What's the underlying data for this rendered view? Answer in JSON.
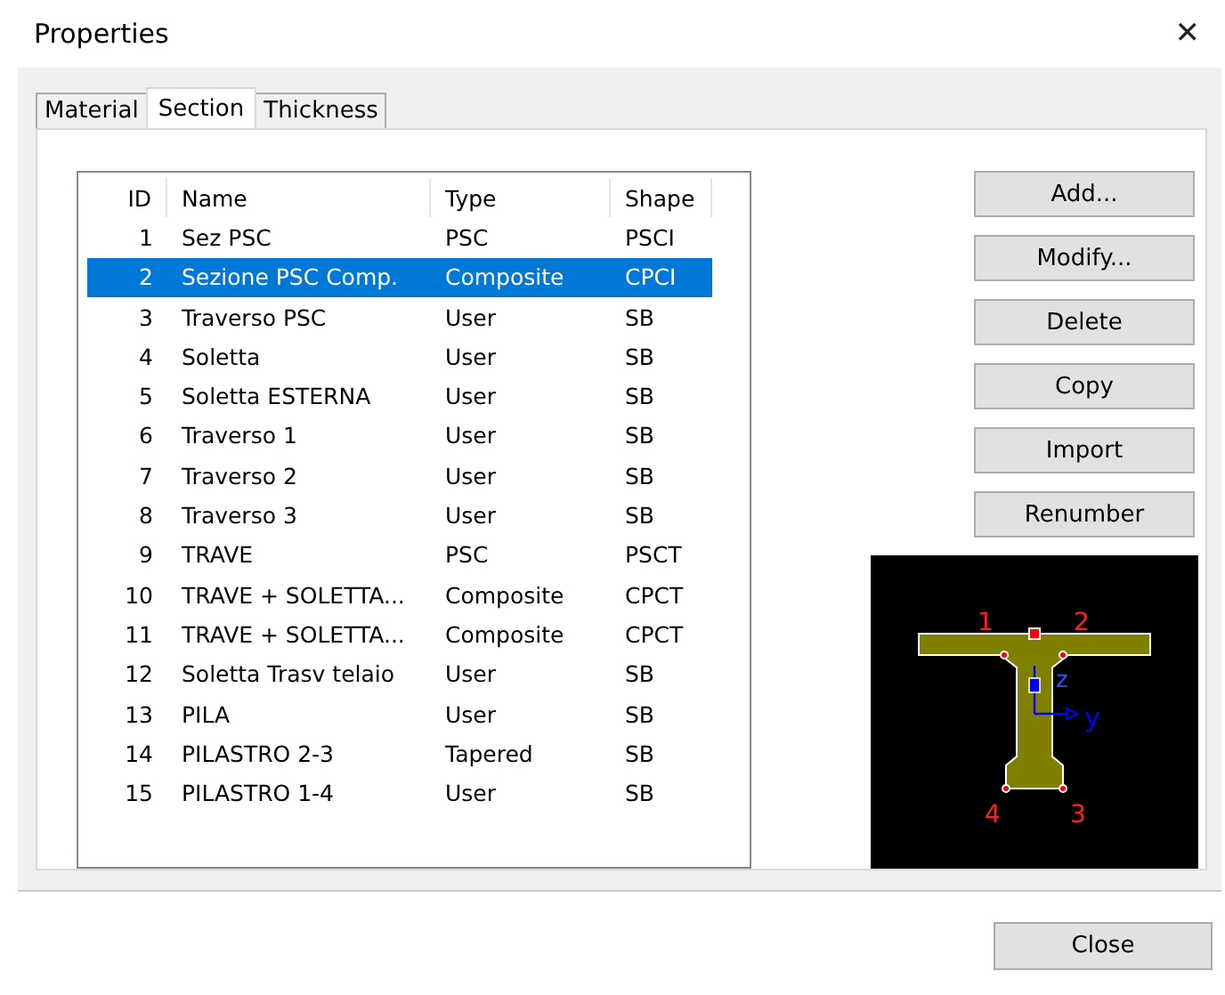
{
  "window": {
    "title": "Properties",
    "close": "✕"
  },
  "tabs": [
    {
      "label": "Material",
      "selected": false
    },
    {
      "label": "Section",
      "selected": true
    },
    {
      "label": "Thickness",
      "selected": false
    }
  ],
  "table": {
    "columns": [
      "ID",
      "Name",
      "Type",
      "Shape"
    ],
    "rows": [
      {
        "id": "1",
        "name": "Sez PSC",
        "type": "PSC",
        "shape": "PSCI",
        "selected": false
      },
      {
        "id": "2",
        "name": "Sezione PSC Comp.",
        "type": "Composite",
        "shape": "CPCI",
        "selected": true
      },
      {
        "id": "3",
        "name": "Traverso PSC",
        "type": "User",
        "shape": "SB",
        "selected": false
      },
      {
        "id": "4",
        "name": "Soletta",
        "type": "User",
        "shape": "SB",
        "selected": false
      },
      {
        "id": "5",
        "name": "Soletta ESTERNA",
        "type": "User",
        "shape": "SB",
        "selected": false
      },
      {
        "id": "6",
        "name": "Traverso 1",
        "type": "User",
        "shape": "SB",
        "selected": false
      },
      {
        "id": "7",
        "name": "Traverso 2",
        "type": "User",
        "shape": "SB",
        "selected": false
      },
      {
        "id": "8",
        "name": "Traverso 3",
        "type": "User",
        "shape": "SB",
        "selected": false
      },
      {
        "id": "9",
        "name": "TRAVE",
        "type": "PSC",
        "shape": "PSCT",
        "selected": false
      },
      {
        "id": "10",
        "name": "TRAVE + SOLETTA...",
        "type": "Composite",
        "shape": "CPCT",
        "selected": false
      },
      {
        "id": "11",
        "name": "TRAVE + SOLETTA...",
        "type": "Composite",
        "shape": "CPCT",
        "selected": false
      },
      {
        "id": "12",
        "name": "Soletta Trasv telaio",
        "type": "User",
        "shape": "SB",
        "selected": false
      },
      {
        "id": "13",
        "name": "PILA",
        "type": "User",
        "shape": "SB",
        "selected": false
      },
      {
        "id": "14",
        "name": "PILASTRO 2-3",
        "type": "Tapered",
        "shape": "SB",
        "selected": false
      },
      {
        "id": "15",
        "name": "PILASTRO 1-4",
        "type": "User",
        "shape": "SB",
        "selected": false
      }
    ]
  },
  "buttons": [
    "Add...",
    "Modify...",
    "Delete",
    "Copy",
    "Import",
    "Renumber"
  ],
  "preview": {
    "point_labels": [
      "1",
      "2",
      "4",
      "3"
    ],
    "axis_labels": [
      "z",
      "y"
    ]
  },
  "footer_buttons": [
    "Close"
  ]
}
